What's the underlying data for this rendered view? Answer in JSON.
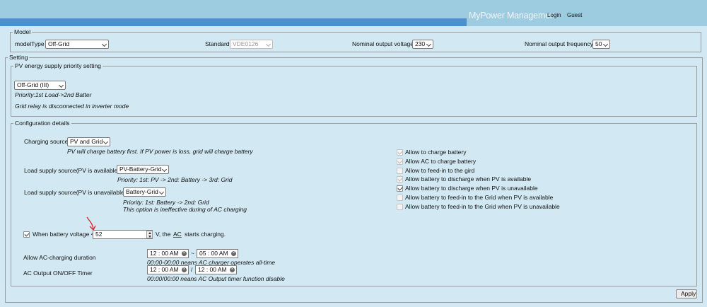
{
  "header": {
    "brand": "MyPower Managemen",
    "login": "Login",
    "guest": "Guest"
  },
  "model": {
    "legend": "Model",
    "model_type_label": "modelType",
    "model_type_value": "Off-Grid",
    "standard_label": "Standard",
    "standard_value": "VDE0126",
    "voltage_label": "Nominal output voltage",
    "voltage_value": "230",
    "frequency_label": "Nominal output frequency",
    "frequency_value": "50"
  },
  "setting": {
    "legend": "Setting",
    "pv_priority": {
      "legend": "PV energy supply priority setting",
      "mode_value": "Off-Grid (III)",
      "note1": "Priority:1st Load->2nd Batter",
      "note2": "Grid relay is disconnected in inverter mode"
    },
    "config": {
      "legend": "Configuration details",
      "charging_source_label": "Charging source",
      "charging_source_value": "PV and Grid",
      "charging_source_note": "PV will charge battery first. If PV power is loss, grid will charge battery",
      "load_pv_available_label": "Load supply source(PV is available)",
      "load_pv_available_value": "PV-Battery-Grid",
      "load_pv_available_note": "Priority: 1st: PV -> 2nd: Battery -> 3rd: Grid",
      "load_pv_unavailable_label": "Load supply source(PV is unavailable)",
      "load_pv_unavailable_value": "Battery-Grid",
      "load_pv_unavailable_note1": "Priority: 1st: Battery -> 2nd: Grid",
      "load_pv_unavailable_note2": "This option is ineffective during of AC charging",
      "battery_voltage_prefix": "When battery voltage <",
      "battery_voltage_value": "52",
      "battery_voltage_suffix": "V, the",
      "battery_voltage_ac": "AC",
      "battery_voltage_end": "starts charging.",
      "ac_charging_label": "Allow AC-charging duration",
      "ac_charging_start": "12 : 00  AM",
      "ac_charging_sep": "~",
      "ac_charging_end": "05 : 00  AM",
      "ac_charging_note": "00:00-00:00 neans AC charger operates all-time",
      "ac_output_label": "AC Output ON/OFF Timer",
      "ac_output_start": "12 : 00  AM",
      "ac_output_sep": "/",
      "ac_output_end": "12 : 00  AM",
      "ac_output_note": "00:00/00:00 neans AC Output timer function disable",
      "options": [
        {
          "label": "Allow to charge battery",
          "checked": true,
          "disabled": true
        },
        {
          "label": "Allow AC to charge battery",
          "checked": true,
          "disabled": true
        },
        {
          "label": "Allow to feed-in to the gird",
          "checked": false,
          "disabled": true
        },
        {
          "label": "Allow battery to discharge when PV is available",
          "checked": true,
          "disabled": true
        },
        {
          "label": "Allow battery to discharge when PV is unavailable",
          "checked": true,
          "disabled": false
        },
        {
          "label": "Allow battery to feed-in to the Grid when PV is available",
          "checked": false,
          "disabled": true
        },
        {
          "label": "Allow battery to feed-in to the Grid when PV is unavailable",
          "checked": false,
          "disabled": true
        }
      ]
    }
  },
  "apply_label": "Apply",
  "colors": {
    "header_bg": "#9dcbe0",
    "header_band": "#4b8fd0",
    "page_bg": "#d2e9f3",
    "annotation": "#e0201a"
  },
  "icons": {
    "annotation_arrow": "red-arrow-icon",
    "select_chevron": "chevron-down-icon",
    "clear": "clear-icon"
  }
}
